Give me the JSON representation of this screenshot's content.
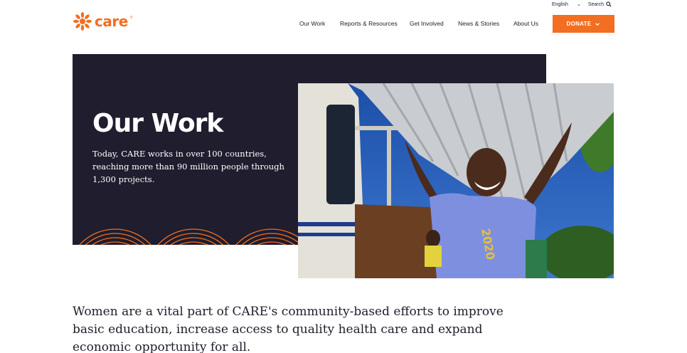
{
  "utility": {
    "language": "English",
    "search_label": "Search"
  },
  "brand": {
    "name": "care",
    "registered": "®",
    "accent_color": "#f26e21",
    "dark_color": "#1f1d2e"
  },
  "nav": {
    "items": [
      {
        "label": "Our Work"
      },
      {
        "label": "Reports & Resources"
      },
      {
        "label": "Get Involved"
      },
      {
        "label": "News & Stories"
      },
      {
        "label": "About Us"
      }
    ],
    "donate_label": "DONATE"
  },
  "hero": {
    "title": "Our Work",
    "description": "Today, CARE works in over 100 countries, reaching more than 90 million people through 1,300 projects."
  },
  "photo": {
    "shirt_text": "2020"
  },
  "intro": {
    "text": "Women are a vital part of CARE's community-based efforts to improve basic education, increase access to quality health care and expand economic opportunity for all."
  },
  "icons": [
    "care-logo-icon",
    "chevron-down-icon",
    "search-icon"
  ]
}
